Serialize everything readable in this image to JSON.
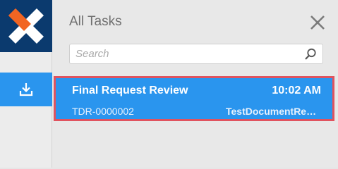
{
  "panel": {
    "title": "All Tasks",
    "close_icon": "close-icon",
    "search": {
      "placeholder": "Search",
      "value": "",
      "icon": "search-icon"
    }
  },
  "rail": {
    "logo_icon": "app-logo-icon",
    "download_icon": "download-icon"
  },
  "tasks": [
    {
      "name": "Final Request Review",
      "time": "10:02 AM",
      "id": "TDR-0000002",
      "document": "TestDocumentRequest"
    }
  ],
  "colors": {
    "brand_navy": "#0b3a6e",
    "logo_orange": "#f26522",
    "accent_blue": "#2a95ee",
    "highlight_red": "#e0535f"
  }
}
